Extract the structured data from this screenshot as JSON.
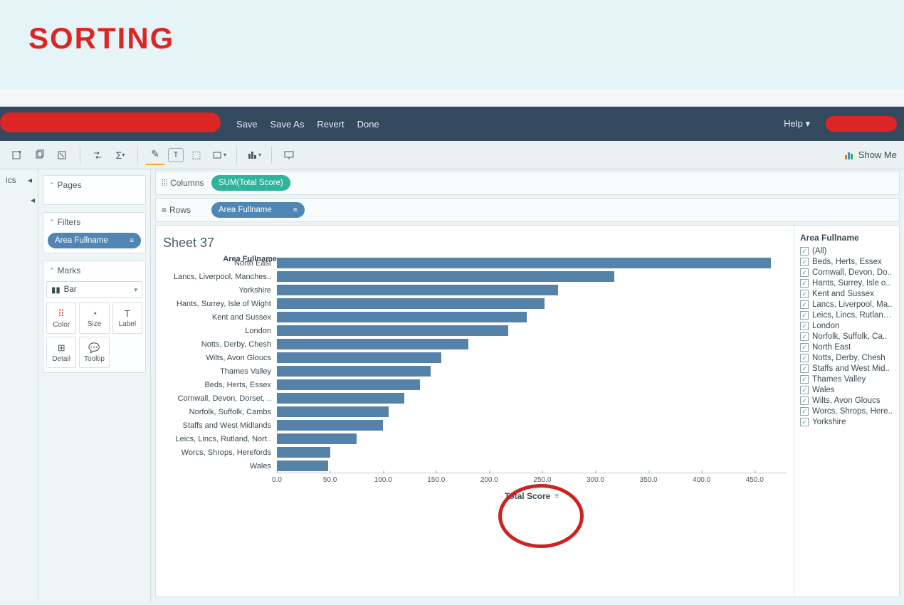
{
  "slide": {
    "title": "SORTING"
  },
  "menu": {
    "save": "Save",
    "save_as": "Save As",
    "revert": "Revert",
    "done": "Done",
    "help": "Help ▾"
  },
  "toolbar": {
    "show_me": "Show Me"
  },
  "left_rail": {
    "label": "ics"
  },
  "side": {
    "pages": "Pages",
    "filters": "Filters",
    "filter_pill": "Area Fullname",
    "marks": "Marks",
    "mark_type": "Bar",
    "cells": {
      "color": "Color",
      "size": "Size",
      "label": "Label",
      "detail": "Detail",
      "tooltip": "Tooltip"
    }
  },
  "shelves": {
    "columns": "Columns",
    "rows": "Rows",
    "col_pill": "SUM(Total Score)",
    "row_pill": "Area Fullname"
  },
  "sheet": {
    "title": "Sheet 37",
    "y_title": "Area Fullname",
    "x_title": "Total Score"
  },
  "chart_data": {
    "type": "bar",
    "xlabel": "Total Score",
    "ylabel": "Area Fullname",
    "xlim": [
      0,
      480
    ],
    "ticks": [
      0,
      50,
      100,
      150,
      200,
      250,
      300,
      350,
      400,
      450
    ],
    "tick_labels": [
      "0.0",
      "50.0",
      "100.0",
      "150.0",
      "200.0",
      "250.0",
      "300.0",
      "350.0",
      "400.0",
      "450.0"
    ],
    "categories": [
      "North East",
      "Lancs, Liverpool, Manches..",
      "Yorkshire",
      "Hants, Surrey, Isle of Wight",
      "Kent and Sussex",
      "London",
      "Notts, Derby, Chesh",
      "Wilts, Avon Gloucs",
      "Thames Valley",
      "Beds, Herts, Essex",
      "Cornwall, Devon, Dorset, ..",
      "Norfolk, Suffolk, Cambs",
      "Staffs and West Midlands",
      "Leics, Lincs, Rutland, Nort..",
      "Worcs, Shrops, Herefords",
      "Wales"
    ],
    "values": [
      465,
      318,
      265,
      252,
      235,
      218,
      180,
      155,
      145,
      135,
      120,
      105,
      100,
      75,
      50,
      48
    ]
  },
  "filter_card": {
    "title": "Area Fullname",
    "items": [
      "(All)",
      "Beds, Herts, Essex",
      "Cornwall, Devon, Do..",
      "Hants, Surrey, Isle o..",
      "Kent and Sussex",
      "Lancs, Liverpool, Ma..",
      "Leics, Lincs, Rutland,..",
      "London",
      "Norfolk, Suffolk, Ca..",
      "North East",
      "Notts, Derby, Chesh",
      "Staffs and West Mid..",
      "Thames Valley",
      "Wales",
      "Wilts, Avon Gloucs",
      "Worcs, Shrops, Here..",
      "Yorkshire"
    ]
  }
}
